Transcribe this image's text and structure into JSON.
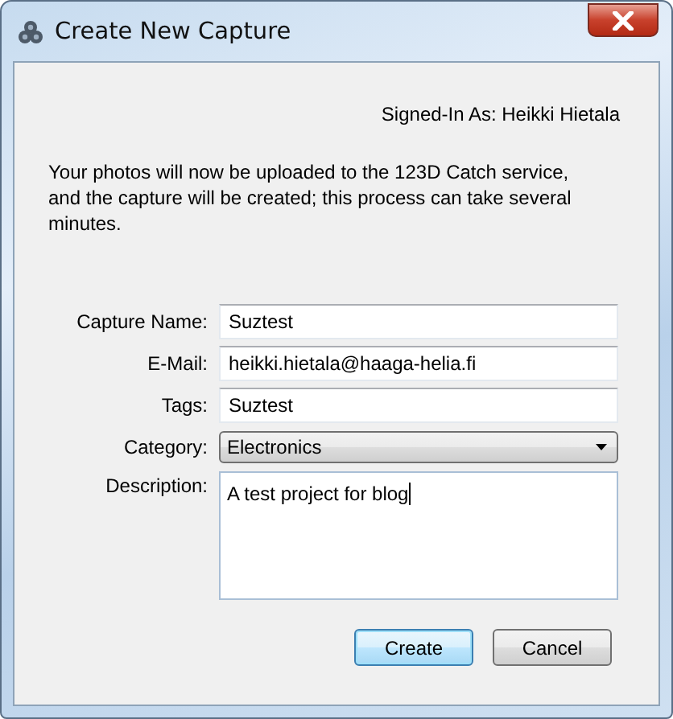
{
  "window": {
    "title": "Create New Capture"
  },
  "signed_in": "Signed-In As: Heikki Hietala",
  "message": "Your photos will now be uploaded to the 123D Catch service, and the capture will be created; this process can take several minutes.",
  "fields": [
    {
      "label": "Capture Name:",
      "kind": "text",
      "value": "Suztest"
    },
    {
      "label": "E-Mail:",
      "kind": "text",
      "value": "heikki.hietala@haaga-helia.fi"
    },
    {
      "label": "Tags:",
      "kind": "text",
      "value": "Suztest"
    },
    {
      "label": "Category:",
      "kind": "select",
      "value": "Electronics"
    },
    {
      "label": "Description:",
      "kind": "textarea",
      "value": "A test project for blog"
    }
  ],
  "buttons": [
    {
      "label": "Create",
      "default": true
    },
    {
      "label": "Cancel",
      "default": false
    }
  ]
}
